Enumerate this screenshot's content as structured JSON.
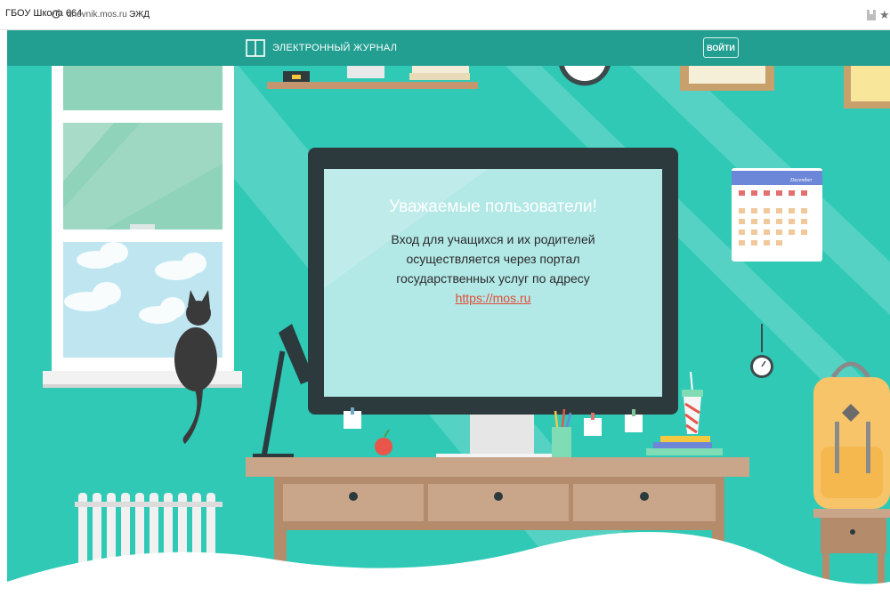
{
  "browser": {
    "tab_title": "ГБОУ Школа 664",
    "url_domain": "dnevnik.mos.ru",
    "url_page": "ЭЖД"
  },
  "header": {
    "brand_text": "ЭЛЕКТРОННЫЙ ЖУРНАЛ",
    "login_label": "ВОЙТИ"
  },
  "notice": {
    "heading": "Уважаемые пользователи!",
    "lines": [
      "Вход для учащихся и их родителей",
      "осуществляется через портал",
      "государственных услуг по адресу"
    ],
    "link_text": "https://mos.ru"
  },
  "calendar": {
    "month": "December"
  },
  "colors": {
    "background": "#2fc9b6",
    "header": "#239f92",
    "screen": "#b2e8e6",
    "link": "#e14a35"
  }
}
